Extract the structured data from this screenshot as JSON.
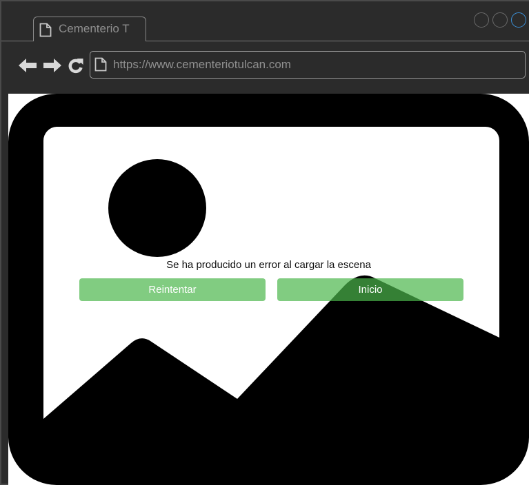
{
  "browser": {
    "tab": {
      "title": "Cementerio T"
    },
    "url": "https://www.cementeriotulcan.com",
    "colors": {
      "chrome": "#2b2b2b",
      "chrome_text": "#8f8f8f",
      "active_control": "#3b8fd6",
      "button_green": "#4cb64c"
    }
  },
  "page": {
    "error_message": "Se ha producido un error al cargar la escena",
    "buttons": {
      "retry": "Reintentar",
      "home": "Inicio"
    }
  }
}
